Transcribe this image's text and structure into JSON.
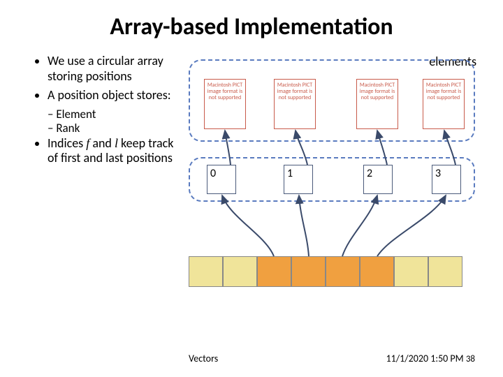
{
  "title": "Array-based Implementation",
  "bullets": {
    "b1": "We use a circular array storing positions",
    "b2": "A position object stores:",
    "sub1": "Element",
    "sub2": "Rank",
    "b3_pre": "Indices ",
    "b3_f": "f",
    "b3_mid": " and ",
    "b3_l": "l",
    "b3_post": " keep track of first and last positions"
  },
  "elements_label": "elements",
  "element_boxes": [
    "Macintosh PICT image format is not supported",
    "Macintosh PICT image format is not supported",
    "Macintosh PICT image format is not supported",
    "Macintosh PICT image format is not supported"
  ],
  "positions": [
    "0",
    "1",
    "2",
    "3"
  ],
  "array_cells": [
    {
      "color": "yellow"
    },
    {
      "color": "yellow"
    },
    {
      "color": "orange"
    },
    {
      "color": "orange"
    },
    {
      "color": "orange"
    },
    {
      "color": "orange"
    },
    {
      "color": "yellow"
    },
    {
      "color": "yellow"
    }
  ],
  "footer": {
    "label": "Vectors",
    "timestamp": "11/1/2020 1:50 PM",
    "page": "38"
  }
}
